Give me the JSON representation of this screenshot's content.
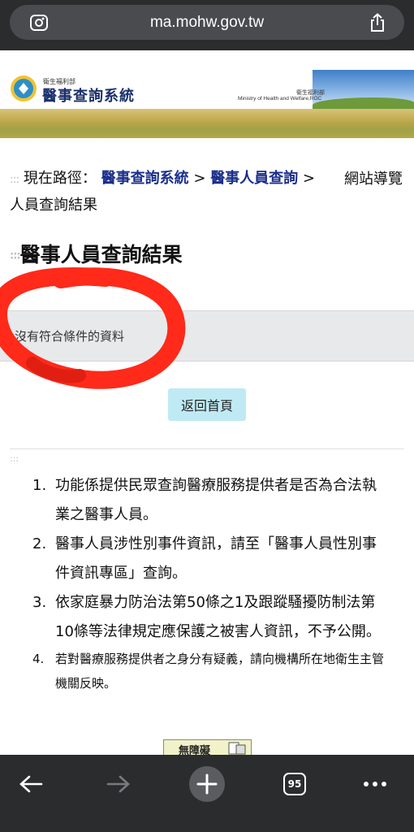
{
  "browser": {
    "url": "ma.mohw.gov.tw",
    "tab_count": "95"
  },
  "banner": {
    "ministry_small": "衛生福利部",
    "system_title": "醫事查詢系統",
    "ministry_cn": "衛生福利部",
    "ministry_en": "Ministry of Health and Welfare,ROC"
  },
  "breadcrumb": {
    "prefix": "現在路徑：",
    "crumb1": "醫事查詢系統",
    "sep": ">",
    "crumb2": "醫事人員查詢",
    "current": "人員查詢結果",
    "sitemap": "網站導覽"
  },
  "page": {
    "title": "醫事人員查詢結果",
    "no_data": "沒有符合條件的資料",
    "home_button": "返回首頁"
  },
  "notes": [
    {
      "num": "1.",
      "text": "功能係提供民眾查詢醫療服務提供者是否為合法執業之醫事人員。"
    },
    {
      "num": "2.",
      "text": "醫事人員涉性別事件資訊，請至「醫事人員性別事件資訊專區」查詢。"
    },
    {
      "num": "3.",
      "text": "依家庭暴力防治法第50條之1及跟蹤騷擾防制法第10條等法律規定應保護之被害人資訊，不予公開。"
    },
    {
      "num": "4.",
      "text": "若對醫療服務提供者之身分有疑義，請向機構所在地衛生主管機關反映。"
    }
  ],
  "a11y_badge": "無障礙",
  "colors": {
    "toolbar": "#2b2c2e",
    "link": "#1a2e8c",
    "button": "#bfeaf4",
    "annotation": "#ff2a1a"
  }
}
